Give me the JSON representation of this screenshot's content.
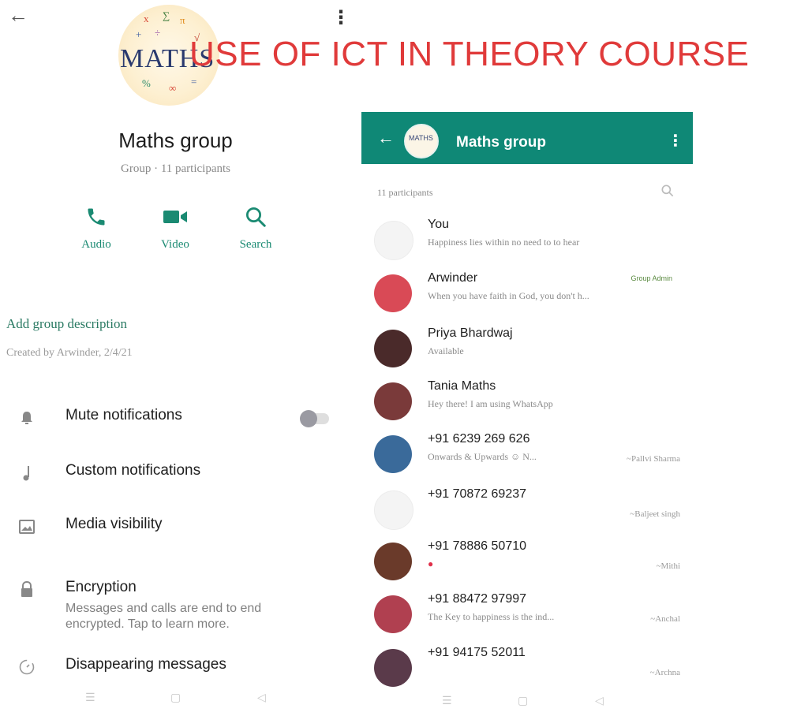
{
  "header": {
    "back_glyph": "←",
    "menu_glyph": "⋮",
    "logo_text": "MATHS",
    "overlay_title": "USE OF ICT IN THEORY COURSE"
  },
  "group": {
    "name": "Maths group",
    "subtitle": "Group · 11 participants",
    "actions": [
      {
        "label": "Audio",
        "icon": "phone-icon"
      },
      {
        "label": "Video",
        "icon": "video-camera-icon"
      },
      {
        "label": "Search",
        "icon": "search-icon"
      }
    ],
    "add_description": "Add group description",
    "created": "Created by Arwinder, 2/4/21"
  },
  "settings": [
    {
      "label": "Mute notifications",
      "icon": "bell-icon"
    },
    {
      "label": "Custom notifications",
      "icon": "music-note-icon"
    },
    {
      "label": "Media visibility",
      "icon": "image-icon"
    },
    {
      "label": "Encryption",
      "icon": "lock-icon",
      "sub": "Messages and calls are end to end encrypted. Tap to learn more."
    },
    {
      "label": "Disappearing messages",
      "icon": "timer-icon"
    }
  ],
  "mute_toggle": {
    "on": false
  },
  "right_panel": {
    "header_title": "Maths group",
    "avatar_text": "MATHS",
    "participants_label": "11 participants",
    "members": [
      {
        "name": "You",
        "status": "Happiness lies within no need to to hear",
        "right": "",
        "badge": "",
        "avatar_color": "#f4f4f4"
      },
      {
        "name": "Arwinder",
        "status": "When you have faith in God, you don't h...",
        "right": "",
        "badge": "Group Admin",
        "avatar_color": "#d94a56"
      },
      {
        "name": "Priya Bhardwaj",
        "status": "Available",
        "right": "",
        "badge": "",
        "avatar_color": "#4a2a2a"
      },
      {
        "name": "Tania Maths",
        "status": "Hey there! I am using WhatsApp",
        "right": "",
        "badge": "",
        "avatar_color": "#7a3a3a"
      },
      {
        "name": "+91 6239 269 626",
        "status": "Onwards & Upwards ☺ N...",
        "right": "~Pallvi Sharma",
        "badge": "",
        "avatar_color": "#3a6a9a"
      },
      {
        "name": "+91 70872 69237",
        "status": "",
        "right": "~Baljeet singh",
        "badge": "",
        "avatar_color": "#f4f4f4"
      },
      {
        "name": "+91 78886 50710",
        "status": "●",
        "right": "~Mithi",
        "badge": "",
        "avatar_color": "#6a3a2a"
      },
      {
        "name": "+91 88472 97997",
        "status": "The Key to happiness is the ind...",
        "right": "~Anchal",
        "badge": "",
        "avatar_color": "#b04050"
      },
      {
        "name": "+91 94175 52011",
        "status": "",
        "right": "~Archna",
        "badge": "",
        "avatar_color": "#5a3a4a"
      }
    ]
  },
  "navbar": {
    "recent": "☰",
    "home": "▢",
    "back": "◁"
  }
}
